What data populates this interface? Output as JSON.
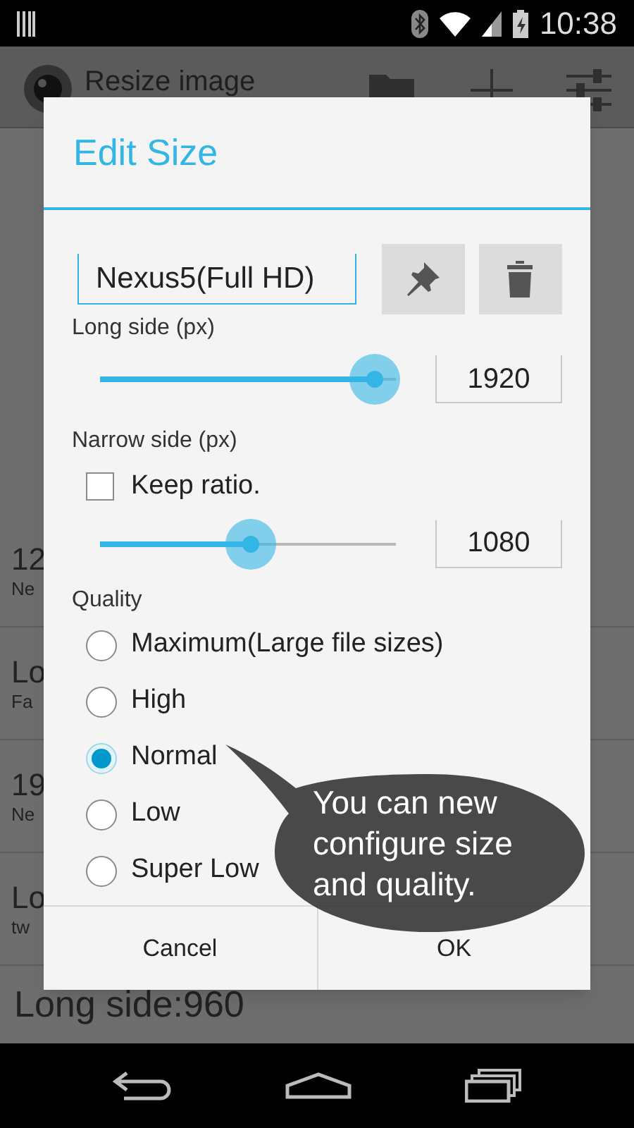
{
  "status_bar": {
    "time": "10:38"
  },
  "app_bar": {
    "title": "Resize image"
  },
  "background_list": {
    "items": [
      {
        "title": "12",
        "subtitle": "Ne"
      },
      {
        "title": "Lo",
        "subtitle": "Fa"
      },
      {
        "title": "19",
        "subtitle": "Ne"
      },
      {
        "title": "Lo",
        "subtitle": "tw"
      }
    ],
    "last_item": "Long side:960"
  },
  "dialog": {
    "title": "Edit Size",
    "name_field": {
      "value": "Nexus5(Full HD)"
    },
    "long_side": {
      "label": "Long side (px)",
      "level": 0.93,
      "value": "1920"
    },
    "narrow_side": {
      "label": "Narrow side (px)",
      "keep_ratio": {
        "label": "Keep ratio.",
        "checked": false
      },
      "level": 0.51,
      "value": "1080"
    },
    "quality": {
      "label": "Quality",
      "options": [
        {
          "label": "Maximum(Large file sizes)",
          "selected": false
        },
        {
          "label": "High",
          "selected": false
        },
        {
          "label": "Normal",
          "selected": true
        },
        {
          "label": "Low",
          "selected": false
        },
        {
          "label": "Super Low",
          "selected": false
        }
      ]
    },
    "buttons": [
      "Cancel",
      "OK"
    ]
  },
  "tooltip": {
    "lines": [
      "You can new",
      "configure size",
      "and quality."
    ]
  }
}
